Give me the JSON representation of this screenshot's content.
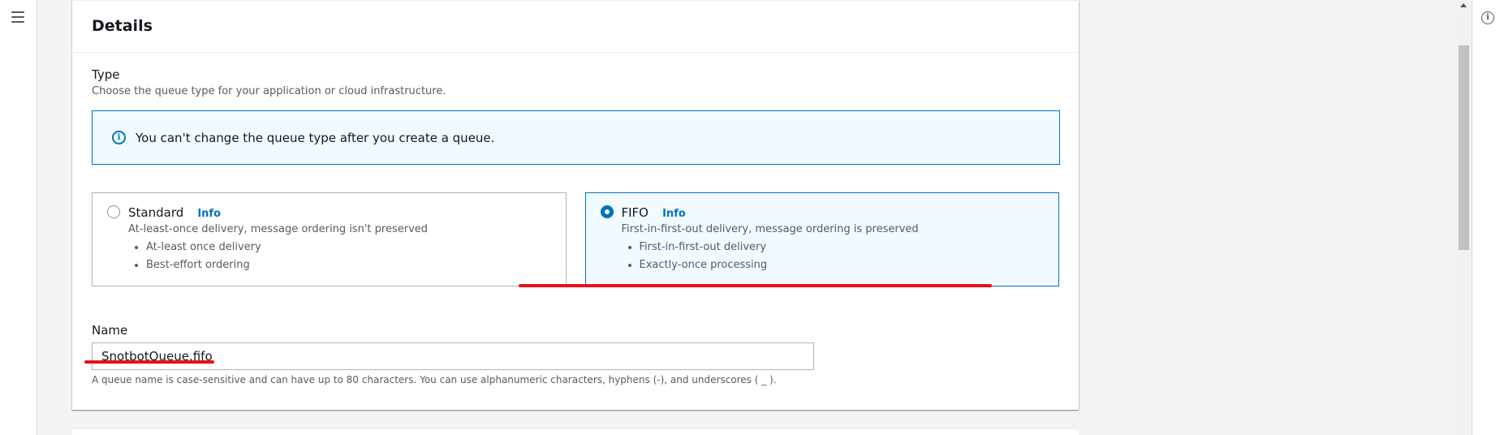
{
  "details": {
    "title": "Details",
    "type_label": "Type",
    "type_description": "Choose the queue type for your application or cloud infrastructure.",
    "alert_text": "You can't change the queue type after you create a queue.",
    "tiles": [
      {
        "title": "Standard",
        "info": "Info",
        "description": "At-least-once delivery, message ordering isn't preserved",
        "bullets": [
          "At-least once delivery",
          "Best-effort ordering"
        ],
        "selected": false
      },
      {
        "title": "FIFO",
        "info": "Info",
        "description": "First-in-first-out delivery, message ordering is preserved",
        "bullets": [
          "First-in-first-out delivery",
          "Exactly-once processing"
        ],
        "selected": true
      }
    ],
    "name_label": "Name",
    "name_value": "SnotbotQueue.fifo",
    "name_constraint": "A queue name is case-sensitive and can have up to 80 characters. You can use alphanumeric characters, hyphens (-), and underscores ( _ )."
  },
  "colors": {
    "accent": "#0073bb",
    "annotation_red": "#e8101a"
  },
  "icons": {
    "menu": "hamburger-icon",
    "info": "info-circle-icon"
  }
}
